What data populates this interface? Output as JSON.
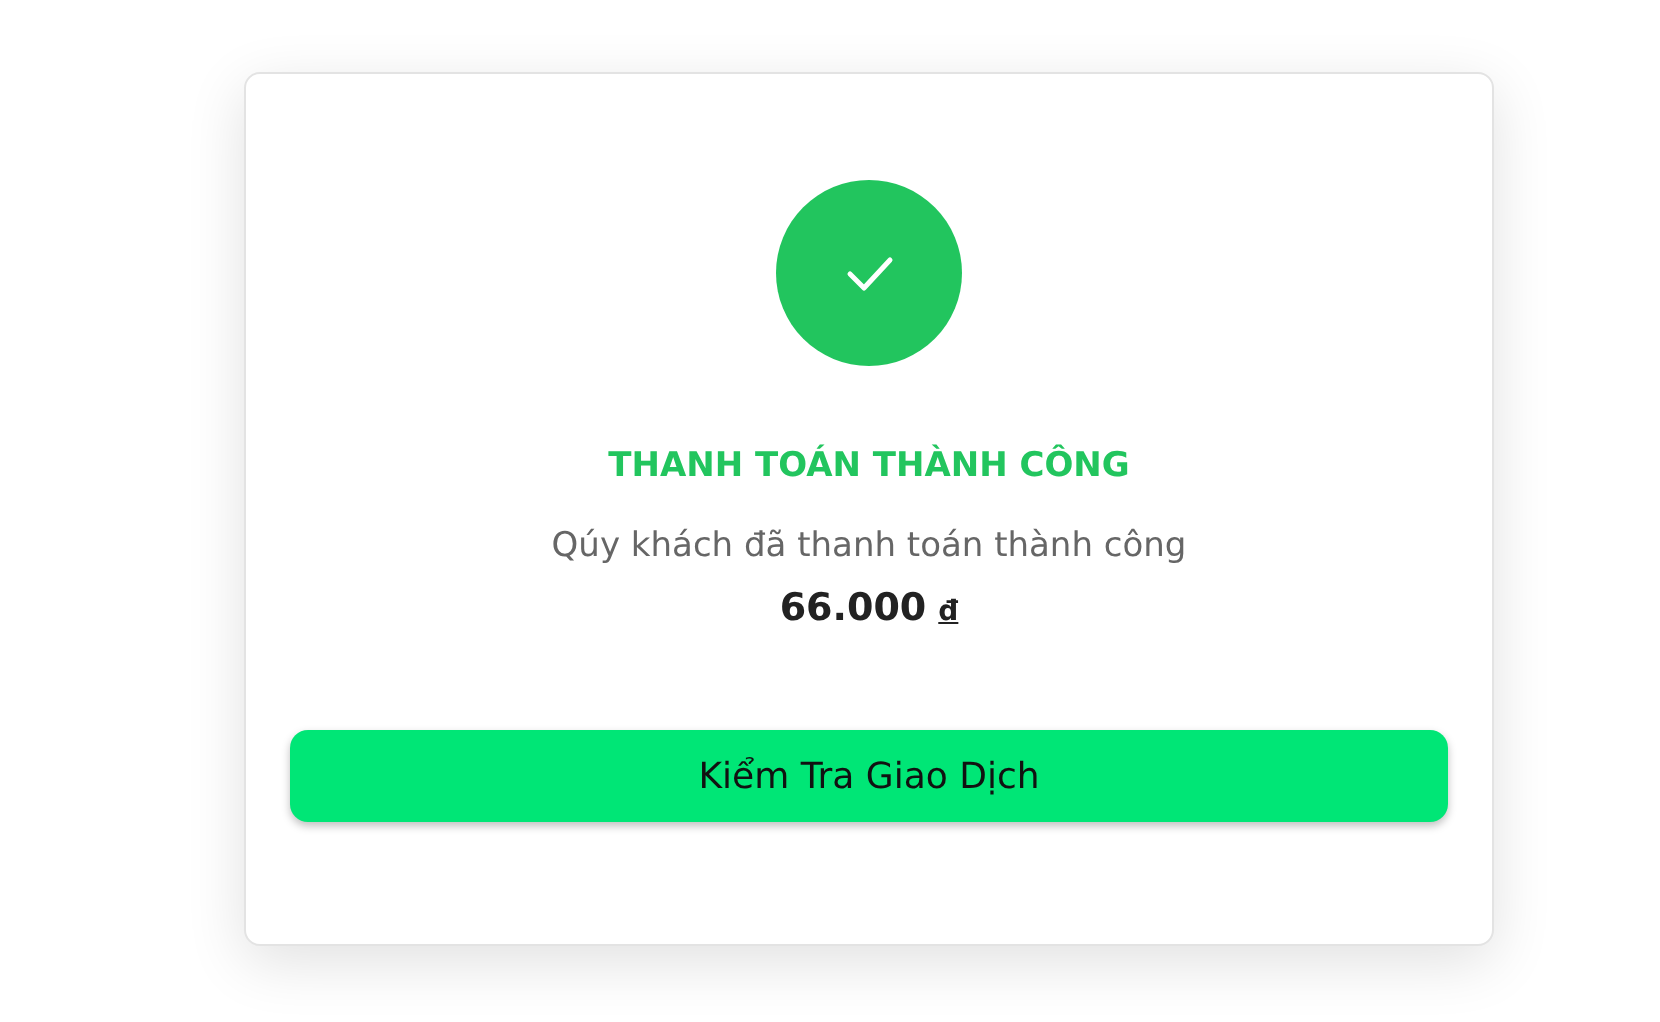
{
  "status": {
    "title": "THANH TOÁN THÀNH CÔNG",
    "message": "Qúy khách đã thanh toán thành công",
    "amount": "66.000",
    "currency": "đ"
  },
  "button": {
    "label": "Kiểm Tra Giao Dịch"
  }
}
